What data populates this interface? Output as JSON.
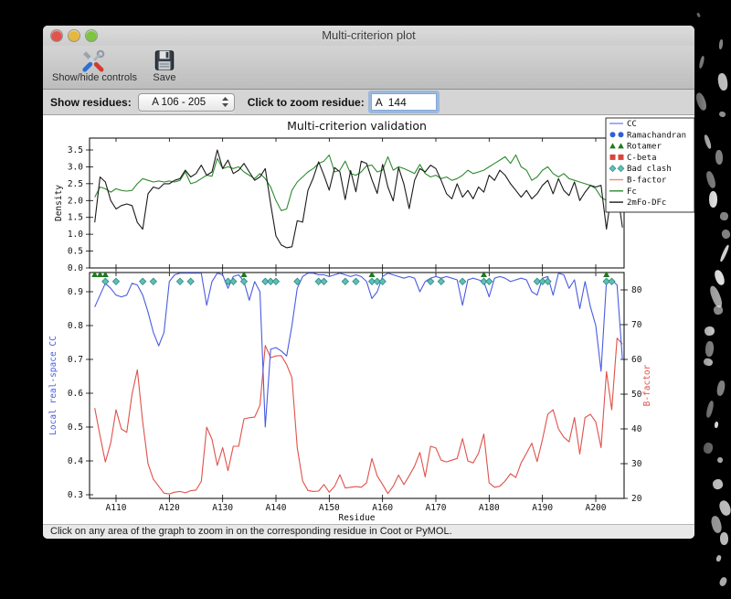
{
  "window": {
    "title": "Multi-criterion plot",
    "traffic_lights": {
      "close": "#df544d",
      "minimize": "#e4b73e",
      "zoom": "#7dc440"
    }
  },
  "toolbar": {
    "show_hide_label": "Show/hide controls",
    "save_label": "Save"
  },
  "controls": {
    "show_residues_label": "Show residues:",
    "show_residues_value": "A 106 - 205",
    "zoom_residue_label": "Click to zoom residue:",
    "zoom_residue_value": "A  144"
  },
  "status_bar": {
    "text": "Click on any area of the graph to zoom in on the corresponding residue in Coot or PyMOL."
  },
  "chart_data": {
    "type": "line",
    "title": "Multi-criterion validation",
    "xlabel": "Residue",
    "x_range": [
      106,
      205
    ],
    "x_step": 1,
    "xtick_residues": [
      110,
      120,
      130,
      140,
      150,
      160,
      170,
      180,
      190,
      200
    ],
    "xtick_labels": [
      "A110",
      "A120",
      "A130",
      "A140",
      "A150",
      "A160",
      "A170",
      "A180",
      "A190",
      "A200"
    ],
    "panels": [
      {
        "name": "density",
        "ylabel": "Density",
        "ylim": [
          0,
          3.85
        ],
        "yticks": [
          0.0,
          0.5,
          1.0,
          1.5,
          2.0,
          2.5,
          3.0,
          3.5
        ],
        "series": [
          {
            "name": "Fc",
            "color": "#2e8b2e",
            "values": [
              2.1,
              2.4,
              2.35,
              2.25,
              2.35,
              2.3,
              2.28,
              2.3,
              2.5,
              2.65,
              2.6,
              2.55,
              2.58,
              2.55,
              2.58,
              2.55,
              2.6,
              2.85,
              2.5,
              2.55,
              2.65,
              2.75,
              2.72,
              3.25,
              2.95,
              3.0,
              2.95,
              3.0,
              2.85,
              2.75,
              2.65,
              2.8,
              2.65,
              2.4,
              2.0,
              1.7,
              1.75,
              2.3,
              2.55,
              2.7,
              2.85,
              2.95,
              3.1,
              3.17,
              3.35,
              2.85,
              2.9,
              3.17,
              2.8,
              2.75,
              2.85,
              3.03,
              3.05,
              2.85,
              2.9,
              3.3,
              2.9,
              3.0,
              2.95,
              2.88,
              2.8,
              3.07,
              2.8,
              2.7,
              2.75,
              2.65,
              2.7,
              2.6,
              2.65,
              2.75,
              2.9,
              2.8,
              2.85,
              2.9,
              3.0,
              3.1,
              3.2,
              3.3,
              3.1,
              3.35,
              3.0,
              2.9,
              2.6,
              2.7,
              2.9,
              3.0,
              2.8,
              2.7,
              2.8,
              2.65,
              2.6,
              2.55,
              2.5,
              2.45,
              2.35,
              2.1,
              2.0,
              2.1,
              2.2,
              2.1
            ]
          },
          {
            "name": "2mFo-DFc",
            "color": "#1a1a1a",
            "values": [
              1.35,
              2.7,
              2.55,
              2.0,
              1.75,
              1.85,
              1.9,
              1.85,
              1.35,
              1.15,
              2.2,
              2.4,
              2.35,
              2.5,
              2.5,
              2.6,
              2.65,
              2.9,
              2.7,
              2.8,
              3.05,
              2.75,
              2.85,
              3.5,
              2.95,
              3.2,
              2.8,
              2.9,
              3.1,
              2.85,
              2.6,
              2.7,
              2.95,
              1.9,
              0.95,
              0.68,
              0.6,
              0.63,
              1.4,
              1.36,
              2.3,
              2.67,
              3.15,
              2.75,
              2.31,
              2.98,
              2.85,
              2.03,
              2.89,
              2.26,
              3.17,
              3.1,
              2.62,
              2.21,
              3.07,
              2.4,
              1.99,
              2.98,
              2.49,
              1.76,
              2.6,
              2.95,
              2.85,
              3.05,
              2.95,
              2.6,
              2.2,
              2.05,
              2.5,
              2.1,
              2.3,
              2.05,
              2.4,
              2.25,
              2.75,
              2.6,
              2.9,
              2.75,
              2.5,
              2.3,
              2.1,
              2.3,
              2.05,
              2.2,
              2.45,
              2.6,
              2.2,
              2.65,
              2.3,
              2.15,
              2.55,
              2.0,
              2.25,
              2.45,
              2.4,
              2.45,
              1.15,
              2.3,
              2.35,
              1.2
            ]
          }
        ]
      },
      {
        "name": "real_space_cc_and_bfactor",
        "left_axis": {
          "label": "Local real-space CC",
          "color": "#4a5ce0",
          "ylim": [
            0.29,
            0.957
          ],
          "yticks": [
            0.3,
            0.4,
            0.5,
            0.6,
            0.7,
            0.8,
            0.9
          ]
        },
        "right_axis": {
          "label": "B-factor",
          "color": "#e0514b",
          "ylim": [
            20,
            85
          ],
          "yticks": [
            20,
            30,
            40,
            50,
            60,
            70,
            80
          ]
        },
        "series": [
          {
            "name": "CC",
            "axis": "left",
            "color": "#4a5ce0",
            "values": [
              0.855,
              0.89,
              0.925,
              0.91,
              0.89,
              0.885,
              0.89,
              0.925,
              0.92,
              0.89,
              0.84,
              0.78,
              0.74,
              0.78,
              0.93,
              0.95,
              0.955,
              0.955,
              0.96,
              0.96,
              0.955,
              0.86,
              0.93,
              0.955,
              0.95,
              0.91,
              0.945,
              0.95,
              0.93,
              0.875,
              0.93,
              0.9,
              0.5,
              0.73,
              0.735,
              0.725,
              0.71,
              0.8,
              0.91,
              0.945,
              0.955,
              0.955,
              0.95,
              0.95,
              0.945,
              0.95,
              0.955,
              0.95,
              0.945,
              0.95,
              0.945,
              0.93,
              0.88,
              0.9,
              0.945,
              0.955,
              0.95,
              0.945,
              0.94,
              0.945,
              0.94,
              0.9,
              0.93,
              0.94,
              0.945,
              0.94,
              0.945,
              0.94,
              0.935,
              0.86,
              0.935,
              0.94,
              0.935,
              0.93,
              0.885,
              0.94,
              0.945,
              0.94,
              0.93,
              0.935,
              0.94,
              0.935,
              0.9,
              0.89,
              0.94,
              0.945,
              0.89,
              0.955,
              0.95,
              0.91,
              0.935,
              0.85,
              0.93,
              0.855,
              0.8,
              0.665,
              0.93,
              0.935,
              0.92,
              0.7
            ]
          },
          {
            "name": "B-factor",
            "axis": "right",
            "color": "#e0514b",
            "values": [
              46,
              38,
              30.5,
              36,
              45.5,
              40,
              39,
              50,
              57,
              42,
              30,
              25.5,
              23.5,
              21.5,
              21.3,
              21.8,
              22,
              21.6,
              22.2,
              22.4,
              24.9,
              40.5,
              37,
              29.5,
              34.6,
              28,
              35,
              35,
              42.9,
              43.2,
              43.4,
              46.8,
              64,
              60.5,
              61,
              61.1,
              58.5,
              54.7,
              34.6,
              25,
              22.3,
              22,
              22.1,
              24,
              21.8,
              23.5,
              26.8,
              23,
              23.2,
              23.4,
              23.2,
              24.5,
              31.5,
              26.5,
              24,
              21.4,
              23.5,
              26.7,
              24,
              26.5,
              29.3,
              33.2,
              26.2,
              35,
              34.5,
              31,
              30.5,
              31,
              31.5,
              37.2,
              30.8,
              30.2,
              33,
              38.5,
              24.5,
              23.2,
              23.5,
              25,
              27.1,
              26,
              30.2,
              33,
              35.9,
              30.6,
              37,
              44.2,
              45.5,
              40,
              37.6,
              36.3,
              43.3,
              32.8,
              43.3,
              44.2,
              42,
              34.6,
              56.5,
              45.5,
              66.1,
              64.4
            ]
          }
        ],
        "markers": [
          {
            "name": "Rotamer",
            "shape": "triangle",
            "color": "#1e7a1e",
            "residues": [
              106,
              107,
              108,
              134,
              158,
              179,
              202
            ]
          },
          {
            "name": "Bad clash",
            "shape": "diamond",
            "color": "#5fbfb7",
            "edge_color": "#2e8c82",
            "residues": [
              108,
              110,
              115,
              117,
              122,
              124,
              131,
              132,
              134,
              138,
              139,
              140,
              144,
              148,
              149,
              153,
              155,
              158,
              159,
              160,
              169,
              171,
              175,
              179,
              180,
              189,
              190,
              191,
              202,
              203
            ]
          }
        ]
      }
    ],
    "legend": {
      "position": "upper right",
      "entries": [
        {
          "label": "CC",
          "swatch": "line",
          "color": "#7a8cf0"
        },
        {
          "label": "Ramachandran",
          "swatch": "circles",
          "color": "#2f5fd4"
        },
        {
          "label": "Rotamer",
          "swatch": "triangles",
          "color": "#1e7a1e"
        },
        {
          "label": "C-beta",
          "swatch": "squares",
          "color": "#d9453c"
        },
        {
          "label": "Bad clash",
          "swatch": "diamonds",
          "color": "#5fbfb7"
        },
        {
          "label": "B-factor",
          "swatch": "line",
          "color": "#f0887c"
        },
        {
          "label": "Fc",
          "swatch": "line",
          "color": "#2e8b2e"
        },
        {
          "label": "2mFo-DFc",
          "swatch": "line",
          "color": "#1a1a1a"
        }
      ]
    }
  }
}
